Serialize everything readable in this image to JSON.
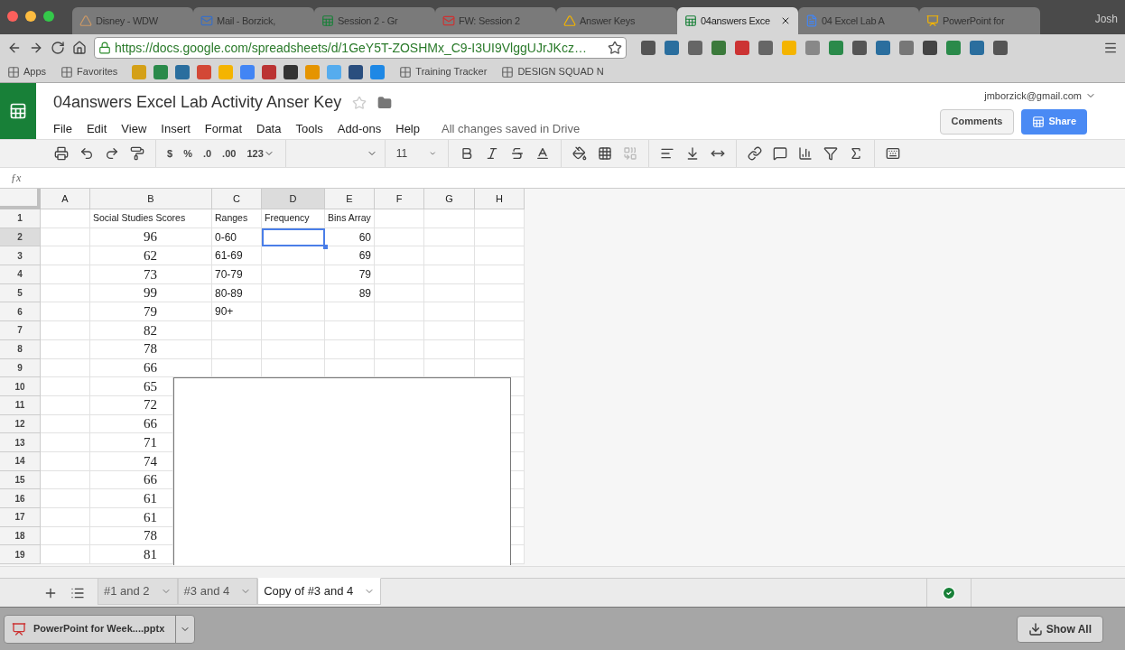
{
  "browser": {
    "tabs": [
      {
        "label": "Disney - WDW",
        "selected": false
      },
      {
        "label": "Mail - Borzick,",
        "selected": false
      },
      {
        "label": "Session 2 - Gr",
        "selected": false
      },
      {
        "label": "FW: Session 2",
        "selected": false
      },
      {
        "label": "Answer Keys",
        "selected": false
      },
      {
        "label": "04answers Exce",
        "selected": true
      },
      {
        "label": "04 Excel Lab A",
        "selected": false
      },
      {
        "label": "PowerPoint for",
        "selected": false
      }
    ],
    "profile": "Josh",
    "url": "https://docs.google.com/spreadsheets/d/1GeY5T-ZOSHMx_C9-I3UI9VlggUJrJKcz…",
    "bookmarks": [
      {
        "label": "Apps"
      },
      {
        "label": "Favorites"
      },
      {
        "label": "Training Tracker"
      },
      {
        "label": "DESIGN SQUAD N"
      }
    ]
  },
  "doc": {
    "title": "04answers Excel Lab Activity Anser Key",
    "menu": [
      "File",
      "Edit",
      "View",
      "Insert",
      "Format",
      "Data",
      "Tools",
      "Add-ons",
      "Help"
    ],
    "save_status": "All changes saved in Drive",
    "account": "jmborzick@gmail.com",
    "comments": "Comments",
    "share": "Share"
  },
  "formula_bar": {
    "label": "ƒx"
  },
  "toolbar": {
    "number_formats": [
      "$",
      "%",
      ".0",
      ".00",
      "123"
    ],
    "font_size": "11"
  },
  "sheet": {
    "columns": [
      {
        "label": "A",
        "selected": false
      },
      {
        "label": "B",
        "selected": false
      },
      {
        "label": "C",
        "selected": false
      },
      {
        "label": "D",
        "selected": true
      },
      {
        "label": "E",
        "selected": false
      },
      {
        "label": "F",
        "selected": false
      },
      {
        "label": "G",
        "selected": false
      },
      {
        "label": "H",
        "selected": false
      }
    ],
    "rows": [
      {
        "row": "1",
        "selected": false,
        "b": "Social Studies Scores",
        "c": "Ranges",
        "d": "Frequency",
        "e": "Bins Array"
      },
      {
        "row": "2",
        "selected": true,
        "b": "96",
        "c": "0-60",
        "e": "60"
      },
      {
        "row": "3",
        "selected": false,
        "b": "62",
        "c": "61-69",
        "e": "69"
      },
      {
        "row": "4",
        "selected": false,
        "b": "73",
        "c": "70-79",
        "e": "79"
      },
      {
        "row": "5",
        "selected": false,
        "b": "99",
        "c": "80-89",
        "e": "89"
      },
      {
        "row": "6",
        "selected": false,
        "b": "79",
        "c": "90+"
      },
      {
        "row": "7",
        "selected": false,
        "b": "82"
      },
      {
        "row": "8",
        "selected": false,
        "b": "78"
      },
      {
        "row": "9",
        "selected": false,
        "b": "66"
      },
      {
        "row": "10",
        "selected": false,
        "b": "65"
      },
      {
        "row": "11",
        "selected": false,
        "b": "72"
      },
      {
        "row": "12",
        "selected": false,
        "b": "66"
      },
      {
        "row": "13",
        "selected": false,
        "b": "71"
      },
      {
        "row": "14",
        "selected": false,
        "b": "74"
      },
      {
        "row": "15",
        "selected": false,
        "b": "66"
      },
      {
        "row": "16",
        "selected": false,
        "b": "61"
      },
      {
        "row": "17",
        "selected": false,
        "b": "61"
      },
      {
        "row": "18",
        "selected": false,
        "b": "78"
      },
      {
        "row": "19",
        "selected": false,
        "b": "81"
      }
    ]
  },
  "sheet_tabs": [
    {
      "label": "#1 and 2",
      "selected": false
    },
    {
      "label": "#3 and 4",
      "selected": false
    },
    {
      "label": "Copy of #3 and 4",
      "selected": true
    }
  ],
  "downloads": {
    "file": "PowerPoint for Week....pptx",
    "show_all": "Show All"
  }
}
